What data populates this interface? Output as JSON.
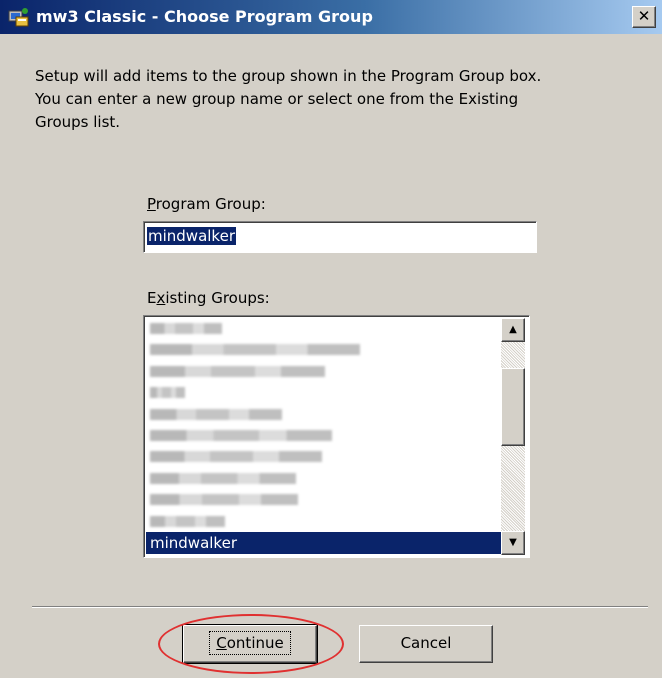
{
  "window": {
    "title": "mw3 Classic - Choose Program Group",
    "close_glyph": "✕"
  },
  "intro_lines": [
    "Setup will add items to the group shown in the Program Group box.",
    "You can enter a new group name or select one from the Existing",
    "Groups list."
  ],
  "program_group": {
    "label_mnemonic": "P",
    "label_rest": "rogram Group:",
    "value": "mindwalker"
  },
  "existing_groups": {
    "label_first": "E",
    "label_mnemonic": "x",
    "label_rest": "isting Groups:",
    "items_obscured": 10,
    "selected_item": "mindwalker"
  },
  "buttons": {
    "continue_mnemonic": "C",
    "continue_rest": "ontinue",
    "cancel": "Cancel"
  },
  "icons": [
    "app-setup-icon",
    "close-icon",
    "scroll-up-arrow-icon",
    "scroll-down-arrow-icon"
  ],
  "colors": {
    "title_bar": "#0a246a",
    "selection": "#0a246a",
    "face": "#d4d0c8",
    "annotation": "#e03030"
  }
}
